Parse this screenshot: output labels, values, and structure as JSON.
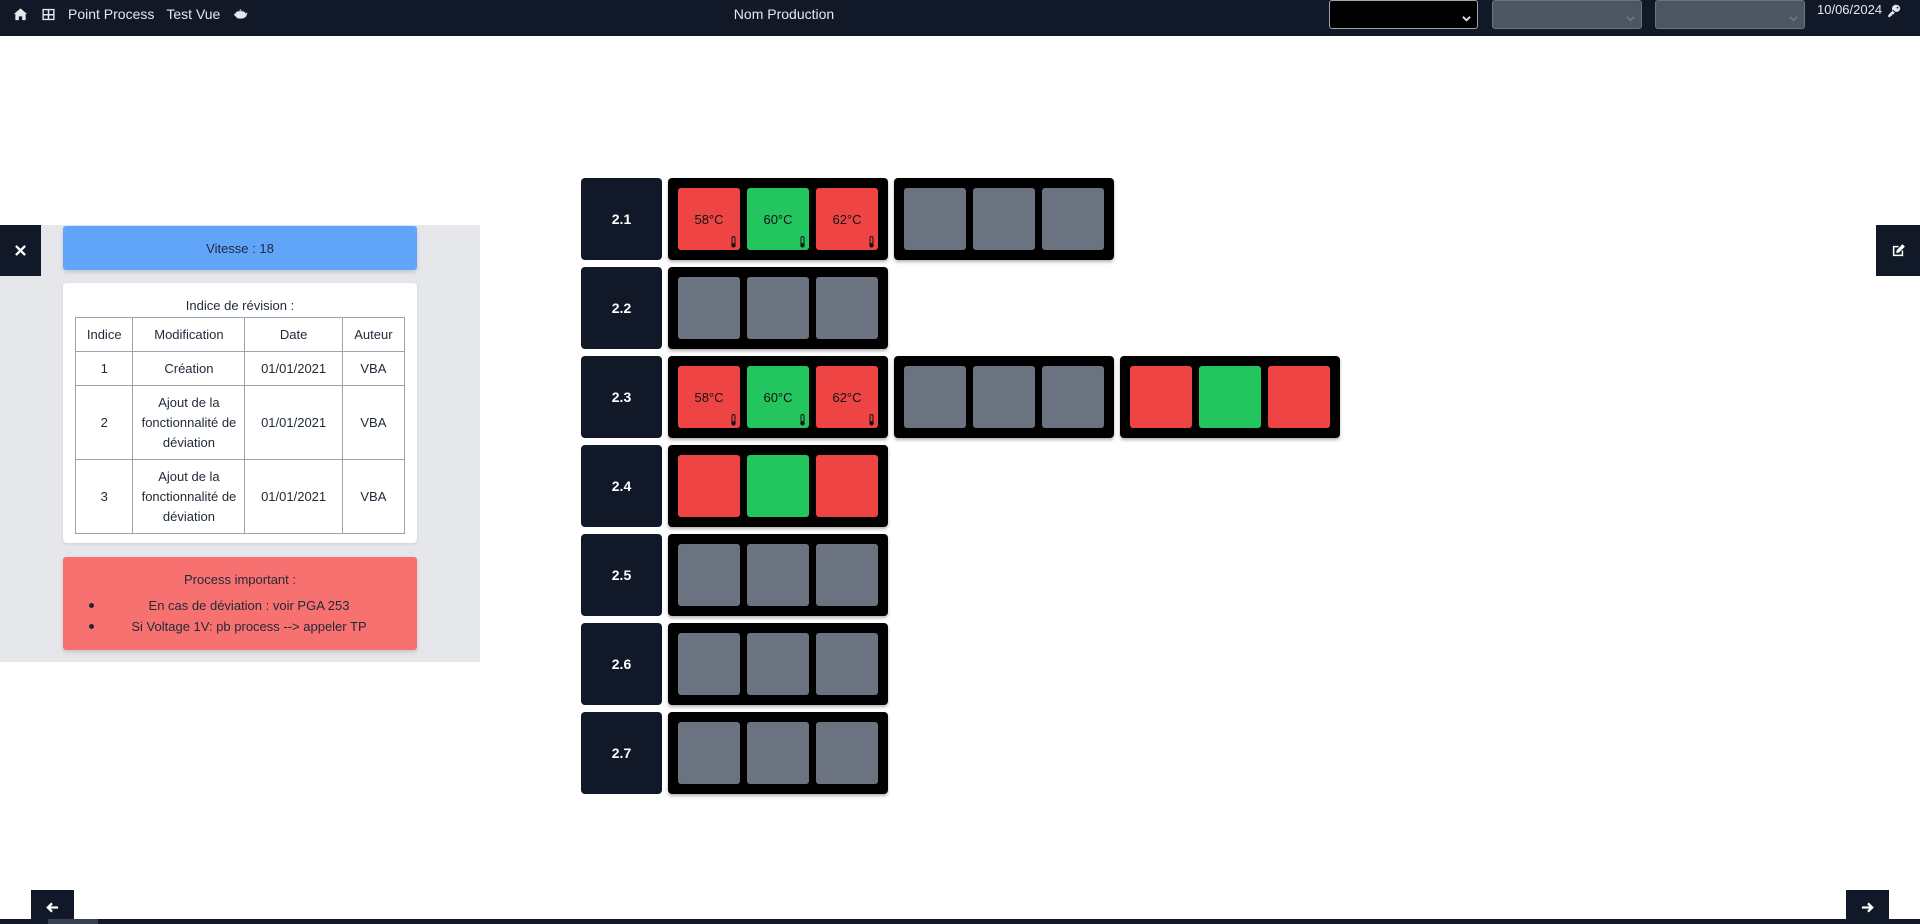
{
  "topbar": {
    "nav_links": [
      "Point Process",
      "Test Vue"
    ],
    "center_title": "Nom Production",
    "date": "10/06/2024",
    "icons": [
      "home-icon",
      "grid-icon",
      "teapot-icon",
      "key-icon"
    ]
  },
  "side_panel": {
    "vitesse": "Vitesse : 18",
    "revision_title": "Indice de révision :",
    "revision_headers": [
      "Indice",
      "Modification",
      "Date",
      "Auteur"
    ],
    "revisions": [
      {
        "indice": "1",
        "modification": "Création",
        "date": "01/01/2021",
        "auteur": "VBA"
      },
      {
        "indice": "2",
        "modification": "Ajout de la fonctionnalité de déviation",
        "date": "01/01/2021",
        "auteur": "VBA"
      },
      {
        "indice": "3",
        "modification": "Ajout de la fonctionnalité de déviation",
        "date": "01/01/2021",
        "auteur": "VBA"
      }
    ],
    "important_title": "Process important :",
    "important_items": [
      "En cas de déviation : voir PGA 253",
      "Si Voltage 1V: pb process --> appeler TP"
    ]
  },
  "colors": {
    "red": "#ef4444",
    "green": "#22c55e",
    "gray": "#6b7280",
    "dark": "#111827",
    "blue": "#60a5fa",
    "light_red": "#f87171"
  },
  "rows": [
    {
      "label": "2.1",
      "groups": [
        [
          {
            "c": "red",
            "t": "58°C",
            "therm": true
          },
          {
            "c": "green",
            "t": "60°C",
            "therm": true
          },
          {
            "c": "red",
            "t": "62°C",
            "therm": true
          }
        ],
        [
          {
            "c": "gray"
          },
          {
            "c": "gray"
          },
          {
            "c": "gray"
          }
        ]
      ]
    },
    {
      "label": "2.2",
      "groups": [
        [
          {
            "c": "gray"
          },
          {
            "c": "gray"
          },
          {
            "c": "gray"
          }
        ]
      ]
    },
    {
      "label": "2.3",
      "groups": [
        [
          {
            "c": "red",
            "t": "58°C",
            "therm": true
          },
          {
            "c": "green",
            "t": "60°C",
            "therm": true
          },
          {
            "c": "red",
            "t": "62°C",
            "therm": true
          }
        ],
        [
          {
            "c": "gray"
          },
          {
            "c": "gray"
          },
          {
            "c": "gray"
          }
        ],
        [
          {
            "c": "red"
          },
          {
            "c": "green"
          },
          {
            "c": "red"
          }
        ]
      ]
    },
    {
      "label": "2.4",
      "groups": [
        [
          {
            "c": "red"
          },
          {
            "c": "green"
          },
          {
            "c": "red"
          }
        ]
      ]
    },
    {
      "label": "2.5",
      "groups": [
        [
          {
            "c": "gray"
          },
          {
            "c": "gray"
          },
          {
            "c": "gray"
          }
        ]
      ]
    },
    {
      "label": "2.6",
      "groups": [
        [
          {
            "c": "gray"
          },
          {
            "c": "gray"
          },
          {
            "c": "gray"
          }
        ]
      ]
    },
    {
      "label": "2.7",
      "groups": [
        [
          {
            "c": "gray"
          },
          {
            "c": "gray"
          },
          {
            "c": "gray"
          }
        ]
      ]
    }
  ]
}
